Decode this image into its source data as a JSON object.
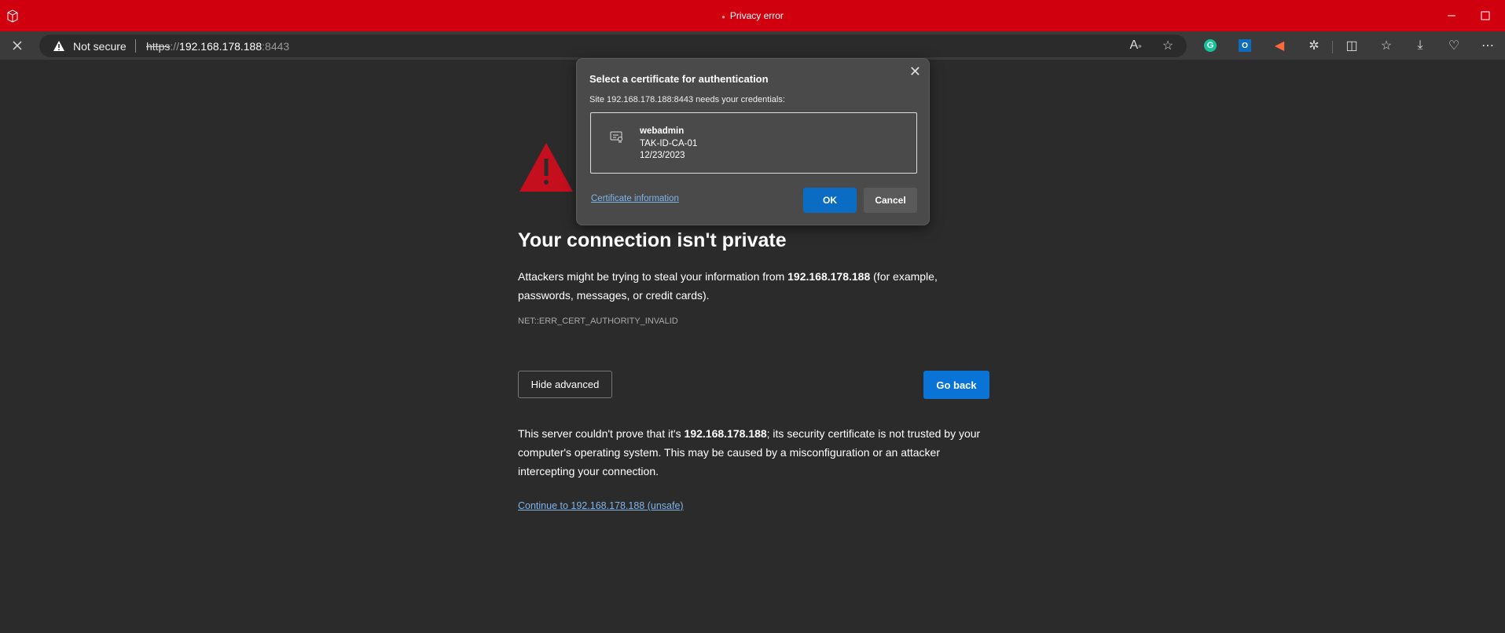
{
  "window": {
    "title": "Privacy error",
    "accent": "#d1000f"
  },
  "address_bar": {
    "security_label": "Not secure",
    "url_scheme": "https",
    "url_sep": "://",
    "url_host": "192.168.178.188",
    "url_port": ":8443"
  },
  "toolbar_icons": [
    "read-aloud-icon",
    "favorite-star-icon",
    "grammarly-icon",
    "outlook-icon",
    "megaphone-icon",
    "extensions-icon",
    "split-screen-icon",
    "favorites-icon",
    "downloads-icon",
    "browser-essentials-icon",
    "more-icon"
  ],
  "page": {
    "heading": "Your connection isn't private",
    "p1_before": "Attackers might be trying to steal your information from ",
    "p1_host": "192.168.178.188",
    "p1_after": " (for example, passwords, messages, or credit cards).",
    "error_code": "NET::ERR_CERT_AUTHORITY_INVALID",
    "hide_advanced": "Hide advanced",
    "go_back": "Go back",
    "p2_before": "This server couldn't prove that it's ",
    "p2_host": "192.168.178.188",
    "p2_after": "; its security certificate is not trusted by your computer's operating system. This may be caused by a misconfiguration or an attacker intercepting your connection.",
    "continue_link": "Continue to 192.168.178.188 (unsafe)"
  },
  "dialog": {
    "title": "Select a certificate for authentication",
    "subtitle": "Site 192.168.178.188:8443 needs your credentials:",
    "certificate": {
      "name": "webadmin",
      "issuer": "TAK-ID-CA-01",
      "date": "12/23/2023"
    },
    "cert_info_link": "Certificate information",
    "ok": "OK",
    "cancel": "Cancel"
  }
}
